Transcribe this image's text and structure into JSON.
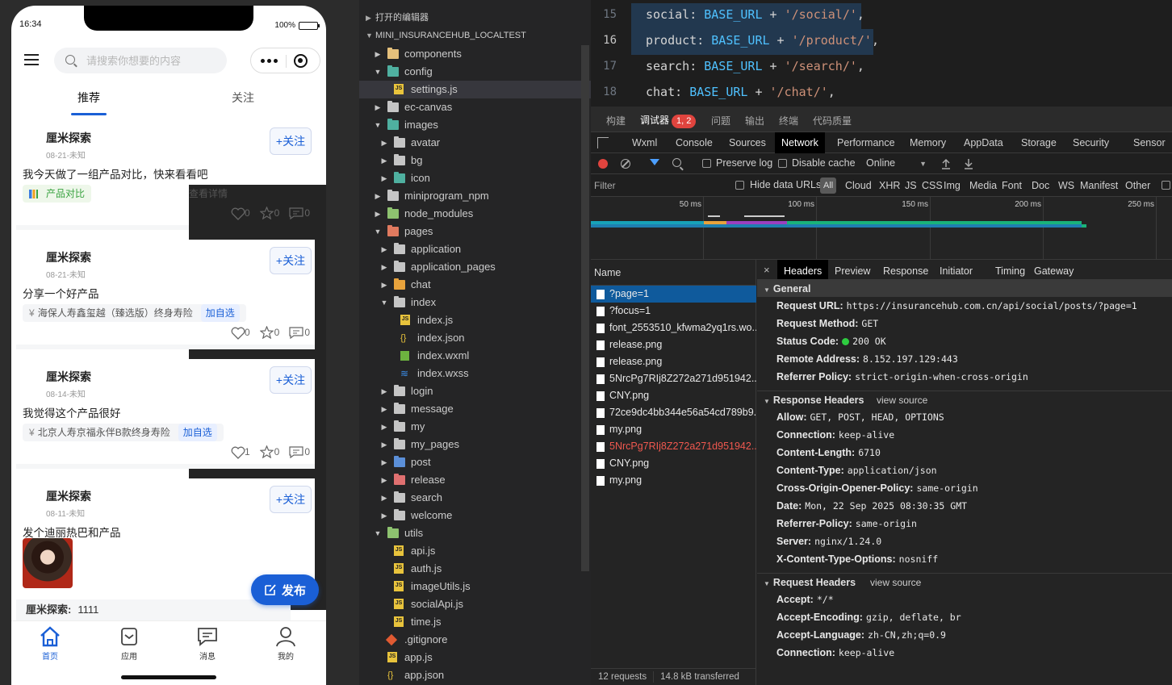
{
  "phone": {
    "time": "16:34",
    "battery": "100%",
    "battery_level": 1.0,
    "search_placeholder": "请搜索你想要的内容",
    "tabs": [
      "推荐",
      "关注"
    ],
    "follow_label": "+关注",
    "posts": [
      {
        "author": "厘米探索",
        "date": "08-21-未知",
        "text": "我今天做了一组产品对比，快来看看吧",
        "tag": "产品对比",
        "tag_action": "查看详情",
        "likes": "0",
        "stars": "0",
        "comments": "0"
      },
      {
        "author": "厘米探索",
        "date": "08-21-未知",
        "text": "分享一个好产品",
        "tag": "海保人寿鑫玺越（臻选版）终身寿险",
        "tag_action": "加自选",
        "likes": "0",
        "stars": "0",
        "comments": "0"
      },
      {
        "author": "厘米探索",
        "date": "08-14-未知",
        "text": "我觉得这个产品很好",
        "tag": "北京人寿京福永伴B款终身寿险",
        "tag_action": "加自选",
        "likes": "1",
        "stars": "0",
        "comments": "0"
      },
      {
        "author": "厘米探索",
        "date": "08-11-未知",
        "text": "发个迪丽热巴和产品"
      }
    ],
    "yen_symbol": "¥",
    "comment_preview": {
      "who": "厘米探索:",
      "text": "1111"
    },
    "publish_label": "发布",
    "nav": [
      "首页",
      "应用",
      "消息",
      "我的"
    ]
  },
  "explorer": {
    "open_editors": "打开的编辑器",
    "project": "MINI_INSURANCEHUB_LOCALTEST",
    "items": [
      {
        "label": "components",
        "depth": 1,
        "icon": "folder-y",
        "open": false
      },
      {
        "label": "config",
        "depth": 1,
        "icon": "folder-t",
        "open": true
      },
      {
        "label": "settings.js",
        "depth": 2,
        "icon": "js",
        "selected": true
      },
      {
        "label": "ec-canvas",
        "depth": 1,
        "icon": "folder",
        "open": false
      },
      {
        "label": "images",
        "depth": 1,
        "icon": "folder-t",
        "open": true
      },
      {
        "label": "avatar",
        "depth": 2,
        "icon": "folder",
        "open": false
      },
      {
        "label": "bg",
        "depth": 2,
        "icon": "folder",
        "open": false
      },
      {
        "label": "icon",
        "depth": 2,
        "icon": "folder-t",
        "open": false
      },
      {
        "label": "miniprogram_npm",
        "depth": 1,
        "icon": "folder",
        "open": false
      },
      {
        "label": "node_modules",
        "depth": 1,
        "icon": "folder-g",
        "open": false
      },
      {
        "label": "pages",
        "depth": 1,
        "icon": "folder-r",
        "open": true
      },
      {
        "label": "application",
        "depth": 2,
        "icon": "folder",
        "open": false
      },
      {
        "label": "application_pages",
        "depth": 2,
        "icon": "folder",
        "open": false
      },
      {
        "label": "chat",
        "depth": 2,
        "icon": "folder-o",
        "open": false
      },
      {
        "label": "index",
        "depth": 2,
        "icon": "folder",
        "open": true
      },
      {
        "label": "index.js",
        "depth": 3,
        "icon": "js"
      },
      {
        "label": "index.json",
        "depth": 3,
        "icon": "json"
      },
      {
        "label": "index.wxml",
        "depth": 3,
        "icon": "wxml"
      },
      {
        "label": "index.wxss",
        "depth": 3,
        "icon": "wxss"
      },
      {
        "label": "login",
        "depth": 2,
        "icon": "folder",
        "open": false
      },
      {
        "label": "message",
        "depth": 2,
        "icon": "folder",
        "open": false
      },
      {
        "label": "my",
        "depth": 2,
        "icon": "folder",
        "open": false
      },
      {
        "label": "my_pages",
        "depth": 2,
        "icon": "folder",
        "open": false
      },
      {
        "label": "post",
        "depth": 2,
        "icon": "folder-b",
        "open": false
      },
      {
        "label": "release",
        "depth": 2,
        "icon": "folder-pk",
        "open": false
      },
      {
        "label": "search",
        "depth": 2,
        "icon": "folder",
        "open": false
      },
      {
        "label": "welcome",
        "depth": 2,
        "icon": "folder",
        "open": false
      },
      {
        "label": "utils",
        "depth": 1,
        "icon": "folder-g",
        "open": true
      },
      {
        "label": "api.js",
        "depth": 2,
        "icon": "js"
      },
      {
        "label": "auth.js",
        "depth": 2,
        "icon": "js"
      },
      {
        "label": "imageUtils.js",
        "depth": 2,
        "icon": "js"
      },
      {
        "label": "socialApi.js",
        "depth": 2,
        "icon": "js"
      },
      {
        "label": "time.js",
        "depth": 2,
        "icon": "js"
      },
      {
        "label": ".gitignore",
        "depth": 1,
        "icon": "git"
      },
      {
        "label": "app.js",
        "depth": 1,
        "icon": "js"
      },
      {
        "label": "app.json",
        "depth": 1,
        "icon": "json"
      }
    ]
  },
  "editor": {
    "lines": [
      {
        "num": "15",
        "key": "social",
        "path": "'/social/'",
        "trail": ","
      },
      {
        "num": "16",
        "key": "product",
        "path": "'/product/'",
        "trail": ",",
        "current": true
      },
      {
        "num": "17",
        "key": "search",
        "path": "'/search/'",
        "trail": ","
      },
      {
        "num": "18",
        "key": "chat",
        "path": "'/chat/'",
        "trail": ","
      }
    ],
    "const_name": "BASE_URL"
  },
  "devtools": {
    "top_tabs": [
      "构建",
      "调试器",
      "问题",
      "输出",
      "终端",
      "代码质量"
    ],
    "errors_badge": "1, 2",
    "panel_tabs": [
      "Wxml",
      "Console",
      "Sources",
      "Network",
      "Performance",
      "Memory",
      "AppData",
      "Storage",
      "Security",
      "Sensor"
    ],
    "preserve_log": "Preserve log",
    "disable_cache": "Disable cache",
    "throttle": "Online",
    "filter_placeholder": "Filter",
    "hide_data_urls": "Hide data URLs",
    "all_chip": "All",
    "types": [
      "Cloud",
      "XHR",
      "JS",
      "CSS",
      "Img",
      "Media",
      "Font",
      "Doc",
      "WS",
      "Manifest",
      "Other"
    ],
    "ticks": [
      "50 ms",
      "100 ms",
      "150 ms",
      "200 ms",
      "250 ms"
    ],
    "name_header": "Name",
    "requests": [
      {
        "name": "?page=1",
        "selected": true
      },
      {
        "name": "?focus=1"
      },
      {
        "name": "font_2553510_kfwma2yq1rs.wo..."
      },
      {
        "name": "release.png"
      },
      {
        "name": "release.png"
      },
      {
        "name": "5NrcPg7RIj8Z272a271d951942..."
      },
      {
        "name": "CNY.png"
      },
      {
        "name": "72ce9dc4bb344e56a54cd789b9..."
      },
      {
        "name": "my.png"
      },
      {
        "name": "5NrcPg7RIj8Z272a271d951942...",
        "error": true
      },
      {
        "name": "CNY.png"
      },
      {
        "name": "my.png"
      }
    ],
    "summary_requests": "12 requests",
    "summary_transferred": "14.8 kB transferred",
    "detail_tabs": [
      "Headers",
      "Preview",
      "Response",
      "Initiator",
      "Timing",
      "Gateway"
    ],
    "close_glyph": "×",
    "general_title": "General",
    "general": [
      {
        "k": "Request URL:",
        "v": "https://insurancehub.com.cn/api/social/posts/?page=1"
      },
      {
        "k": "Request Method:",
        "v": "GET"
      },
      {
        "k": "Status Code:",
        "v": "200 OK",
        "dot": true
      },
      {
        "k": "Remote Address:",
        "v": "8.152.197.129:443"
      },
      {
        "k": "Referrer Policy:",
        "v": "strict-origin-when-cross-origin"
      }
    ],
    "response_title": "Response Headers",
    "view_source": "view source",
    "response": [
      {
        "k": "Allow:",
        "v": "GET, POST, HEAD, OPTIONS"
      },
      {
        "k": "Connection:",
        "v": "keep-alive"
      },
      {
        "k": "Content-Length:",
        "v": "6710"
      },
      {
        "k": "Content-Type:",
        "v": "application/json"
      },
      {
        "k": "Cross-Origin-Opener-Policy:",
        "v": "same-origin"
      },
      {
        "k": "Date:",
        "v": "Mon, 22 Sep 2025 08:30:35 GMT"
      },
      {
        "k": "Referrer-Policy:",
        "v": "same-origin"
      },
      {
        "k": "Server:",
        "v": "nginx/1.24.0"
      },
      {
        "k": "X-Content-Type-Options:",
        "v": "nosniff"
      }
    ],
    "request_title": "Request Headers",
    "request": [
      {
        "k": "Accept:",
        "v": "*/*"
      },
      {
        "k": "Accept-Encoding:",
        "v": "gzip, deflate, br"
      },
      {
        "k": "Accept-Language:",
        "v": "zh-CN,zh;q=0.9"
      },
      {
        "k": "Connection:",
        "v": "keep-alive"
      }
    ]
  },
  "colors": {
    "accent": "#1a5fd6",
    "devtools_selected": "#0f5a9c",
    "error_red": "#e0443e",
    "status_green": "#2ecc40"
  }
}
